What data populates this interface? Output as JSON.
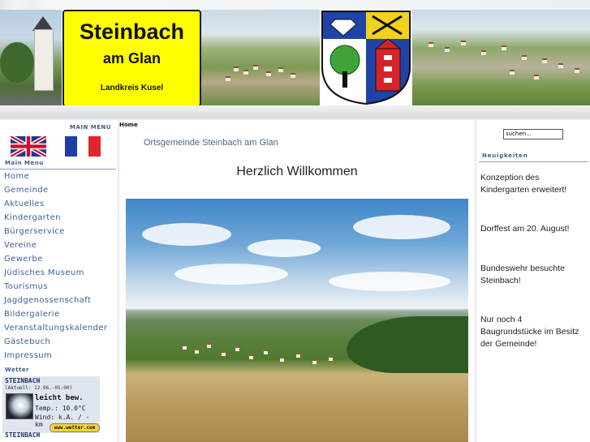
{
  "header": {
    "logo_title": "Steinbach",
    "logo_subtitle": "am Glan",
    "logo_district": "Landkreis Kusel"
  },
  "sidebar": {
    "main_menu_top": "MAIN MENU",
    "flags": [
      "english-flag",
      "french-flag"
    ],
    "main_menu_heading": "Main Menu",
    "items": [
      {
        "label": "Home"
      },
      {
        "label": "Gemeinde"
      },
      {
        "label": "Aktuelles"
      },
      {
        "label": "Kindergarten"
      },
      {
        "label": "Bürgerservice"
      },
      {
        "label": "Vereine"
      },
      {
        "label": "Gewerbe"
      },
      {
        "label": "Jüdisches Museum"
      },
      {
        "label": "Tourismus"
      },
      {
        "label": "Jagdgenossenschaft"
      },
      {
        "label": "Bildergalerie"
      },
      {
        "label": "Veranstaltungskalender"
      },
      {
        "label": "Gästebuch"
      },
      {
        "label": "Impressum"
      }
    ]
  },
  "weather": {
    "heading": "Wetter",
    "town": "STEINBACH",
    "updated": "(Aktuell: 12.06.-05:00)",
    "condition": "leicht bew.",
    "temp": "Temp.: 10.0°C",
    "wind": "Wind: k.A. / - km",
    "badge": "www.wetter.com",
    "town_2": "STEINBACH"
  },
  "main": {
    "breadcrumb": "Home",
    "site_name": "Ortsgemeinde Steinbach am Glan",
    "welcome": "Herzlich Willkommen"
  },
  "rightbar": {
    "search_placeholder": "suchen...",
    "news_heading": "Neuigkeiten",
    "news": [
      "Konzeption des Kindergarten erweitert!",
      "Dorffest am 20. August!",
      "Bundeswehr besuchte Steinbach!",
      "Nur noch 4 Baugrundstücke im Besitz der Gemeinde!"
    ]
  },
  "colors": {
    "logo_yellow": "#ffff00",
    "menu_link": "#3f5f98",
    "heading_blue": "#445a85"
  }
}
